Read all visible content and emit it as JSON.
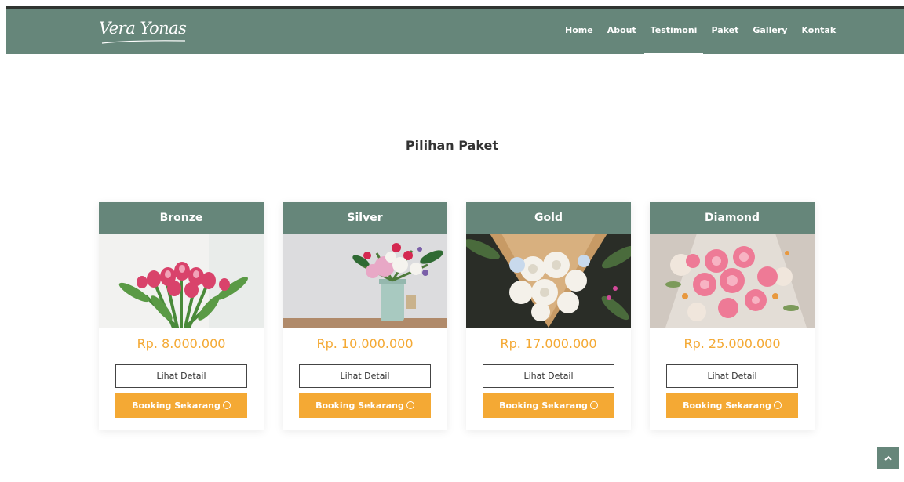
{
  "brand": {
    "logo_text": "Vera Yonas"
  },
  "nav": {
    "items": [
      {
        "label": "Home"
      },
      {
        "label": "About"
      },
      {
        "label": "Testimoni"
      },
      {
        "label": "Paket"
      },
      {
        "label": "Gallery"
      },
      {
        "label": "Kontak"
      }
    ],
    "active": "Testimoni"
  },
  "section": {
    "title": "Pilihan Paket"
  },
  "packages": [
    {
      "name": "Bronze",
      "price": "Rp. 8.000.000",
      "detail_label": "Lihat Detail",
      "booking_label": "Booking Sekarang"
    },
    {
      "name": "Silver",
      "price": "Rp. 10.000.000",
      "detail_label": "Lihat Detail",
      "booking_label": "Booking Sekarang"
    },
    {
      "name": "Gold",
      "price": "Rp. 17.000.000",
      "detail_label": "Lihat Detail",
      "booking_label": "Booking Sekarang"
    },
    {
      "name": "Diamond",
      "price": "Rp. 25.000.000",
      "detail_label": "Lihat Detail",
      "booking_label": "Booking Sekarang"
    }
  ],
  "icons": {
    "booking": "whatsapp-icon",
    "back_to_top": "chevron-up-icon"
  },
  "colors": {
    "primary": "#66867a",
    "accent": "#f4a934",
    "text": "#333333"
  }
}
